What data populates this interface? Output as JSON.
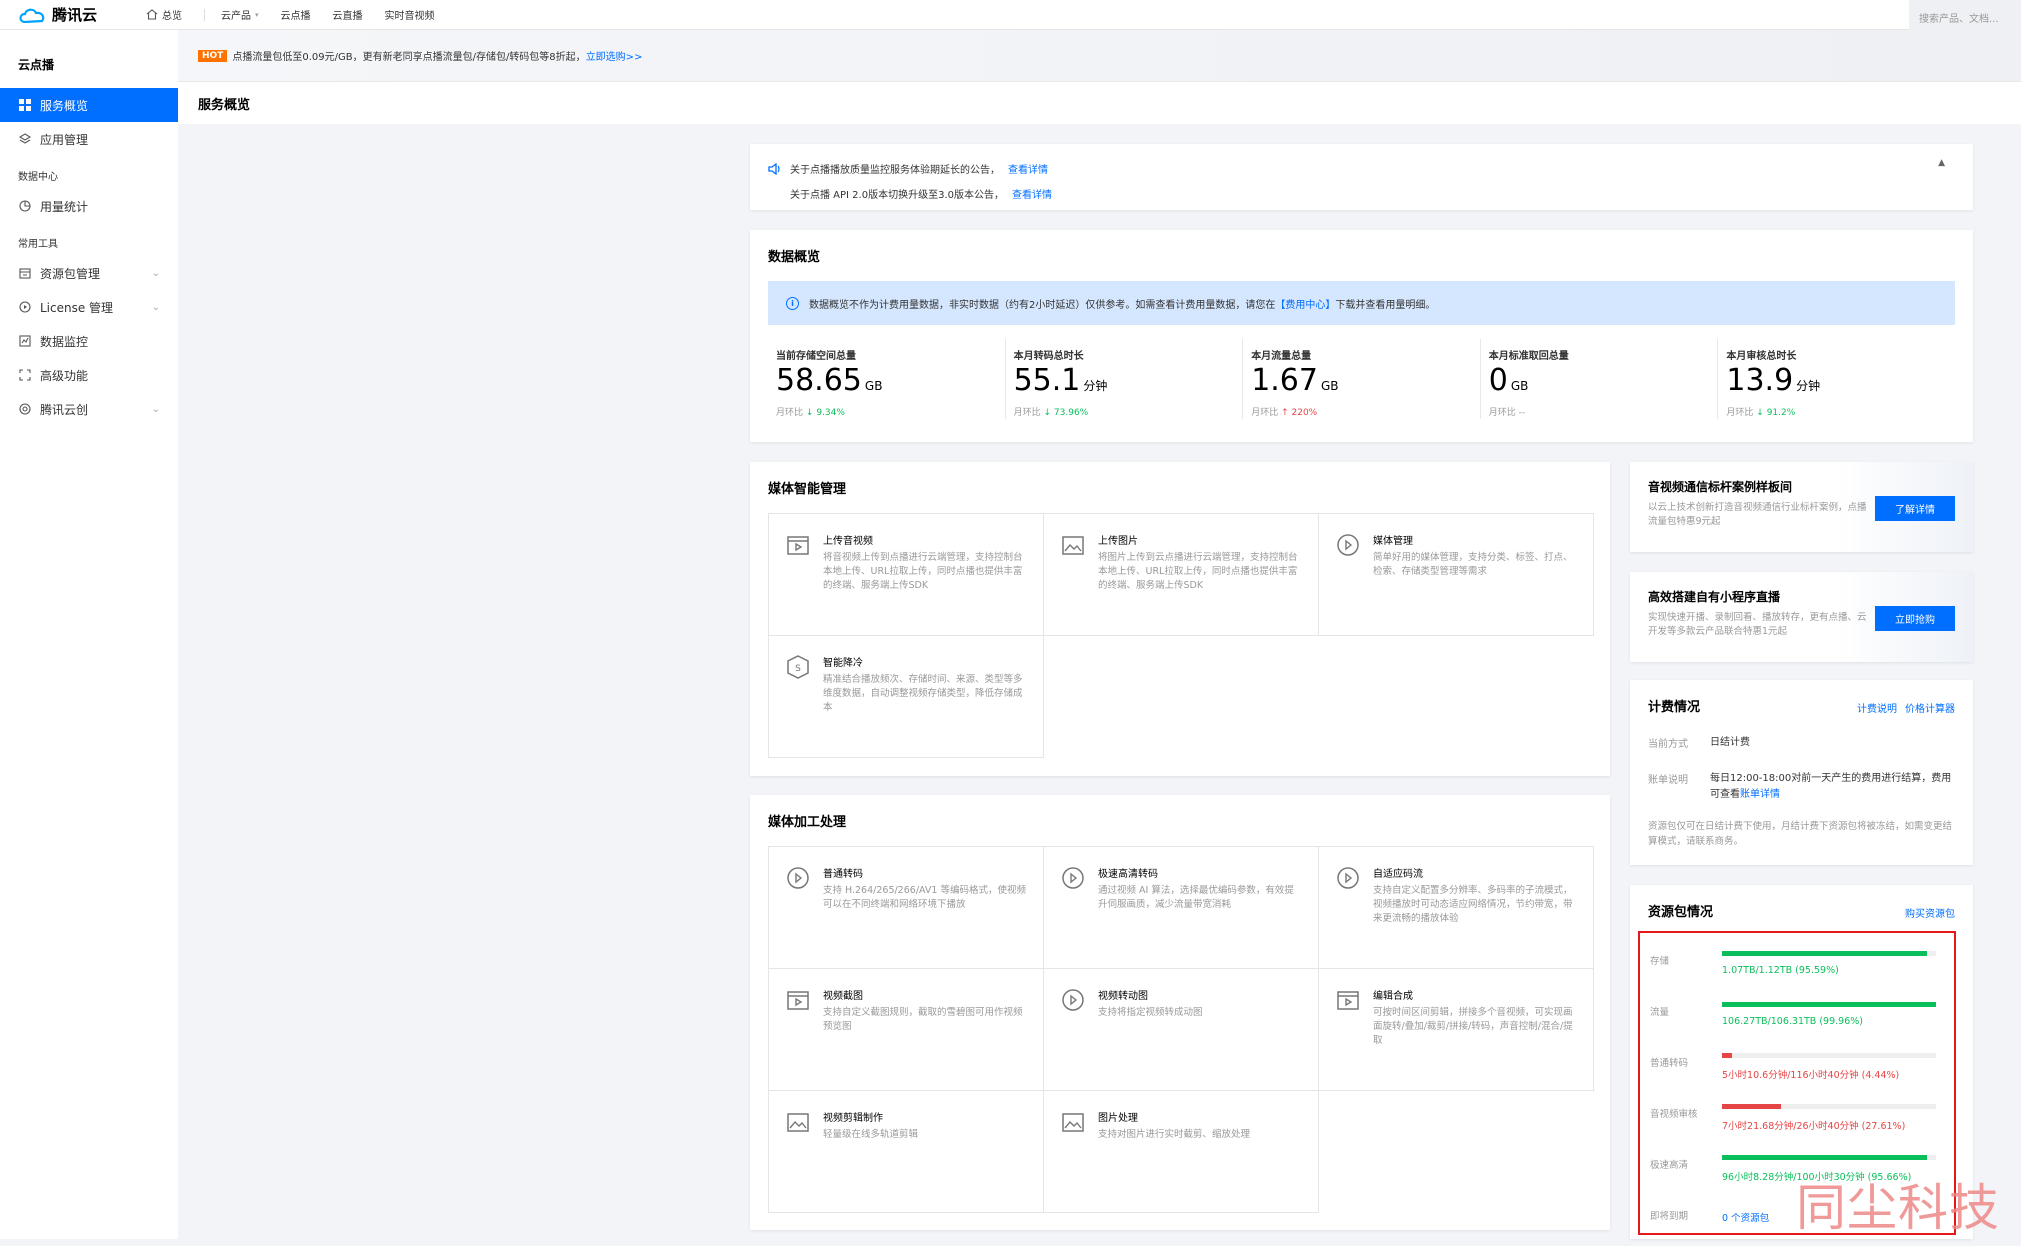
{
  "topbar": {
    "brand": "腾讯云",
    "nav": [
      "总览",
      "云产品",
      "云点播",
      "云直播",
      "实时音视频"
    ],
    "search_placeholder": "搜索产品、文档..."
  },
  "sidebar": {
    "title": "云点播",
    "items": [
      {
        "label": "服务概览"
      },
      {
        "label": "应用管理"
      }
    ],
    "group1": "数据中心",
    "items2": [
      {
        "label": "用量统计"
      }
    ],
    "group2": "常用工具",
    "items3": [
      {
        "label": "资源包管理"
      },
      {
        "label": "License 管理"
      },
      {
        "label": "数据监控"
      },
      {
        "label": "高级功能"
      },
      {
        "label": "腾讯云创"
      }
    ]
  },
  "hotbar": {
    "badge": "HOT",
    "text": "点播流量包低至0.09元/GB，更有新老同享点播流量包/存储包/转码包等8折起，",
    "link": "立即选购>>"
  },
  "page_title": "服务概览",
  "notices": [
    {
      "text": "关于点播播放质量监控服务体验期延长的公告，",
      "link": "查看详情"
    },
    {
      "text": "关于点播 API 2.0版本切换升级至3.0版本公告，",
      "link": "查看详情"
    }
  ],
  "overview": {
    "title": "数据概览",
    "info_pre": "数据概览不作为计费用量数据，非实时数据（约有2小时延迟）仅供参考。如需查看计费用量数据，请您在",
    "info_link": "【费用中心】",
    "info_post": "下载并查看用量明细。",
    "stats": [
      {
        "label": "当前存储空间总量",
        "value": "58.65",
        "unit": "GB",
        "cmp": "月环比",
        "arrow": "↓",
        "pct": "9.34%"
      },
      {
        "label": "本月转码总时长",
        "value": "55.1",
        "unit": "分钟",
        "cmp": "月环比",
        "arrow": "↓",
        "pct": "73.96%"
      },
      {
        "label": "本月流量总量",
        "value": "1.67",
        "unit": "GB",
        "cmp": "月环比",
        "arrow": "↑",
        "pct": "220%"
      },
      {
        "label": "本月标准取回总量",
        "value": "0",
        "unit": "GB",
        "cmp": "月环比",
        "arrow": "",
        "pct": "--"
      },
      {
        "label": "本月审核总时长",
        "value": "13.9",
        "unit": "分钟",
        "cmp": "月环比",
        "arrow": "↓",
        "pct": "91.2%"
      }
    ]
  },
  "media_mgmt": {
    "title": "媒体智能管理",
    "items": [
      {
        "t": "上传音视频",
        "d": "将音视频上传到点播进行云端管理，支持控制台本地上传、URL拉取上传，同时点播也提供丰富的终端、服务端上传SDK"
      },
      {
        "t": "上传图片",
        "d": "将图片上传到云点播进行云端管理，支持控制台本地上传、URL拉取上传，同时点播也提供丰富的终端、服务端上传SDK"
      },
      {
        "t": "媒体管理",
        "d": "简单好用的媒体管理，支持分类、标签、打点、检索、存储类型管理等需求"
      },
      {
        "t": "智能降冷",
        "d": "精准结合播放频次、存储时间、来源、类型等多维度数据，自动调整视频存储类型，降低存储成本"
      }
    ]
  },
  "media_proc": {
    "title": "媒体加工处理",
    "items": [
      {
        "t": "普通转码",
        "d": "支持 H.264/265/266/AV1 等编码格式，使视频可以在不同终端和网络环境下播放"
      },
      {
        "t": "极速高清转码",
        "d": "通过视频 AI 算法，选择最优编码参数，有效提升伺服画质，减少流量带宽消耗"
      },
      {
        "t": "自适应码流",
        "d": "支持自定义配置多分辨率、多码率的子流模式，视频播放时可动态适应网络情况，节约带宽，带来更流畅的播放体验"
      },
      {
        "t": "视频截图",
        "d": "支持自定义截图规则，截取的雪碧图可用作视频预览图"
      },
      {
        "t": "视频转动图",
        "d": "支持将指定视频转成动图"
      },
      {
        "t": "编辑合成",
        "d": "可按时间区间剪辑，拼接多个音视频，可实现画面旋转/叠加/裁剪/拼接/转码，声音控制/混合/提取"
      },
      {
        "t": "视频剪辑制作",
        "d": "轻量级在线多轨道剪辑"
      },
      {
        "t": "图片处理",
        "d": "支持对图片进行实时截剪、缩放处理"
      }
    ]
  },
  "promos": [
    {
      "t": "音视频通信标杆案例样板间",
      "d": "以云上技术创新打造音视频通信行业标杆案例，点播流量包特惠9元起",
      "btn": "了解详情"
    },
    {
      "t": "高效搭建自有小程序直播",
      "d": "实现快速开播、录制回看、播放转存，更有点播、云开发等多款云产品联合特惠1元起",
      "btn": "立即抢购"
    }
  ],
  "billing": {
    "title": "计费情况",
    "link1": "计费说明",
    "link2": "价格计算器",
    "mode_k": "当前方式",
    "mode_v": "日结计费",
    "bill_k": "账单说明",
    "bill_v": "每日12:00-18:00对前一天产生的费用进行结算，费用可查看",
    "bill_link": "账单详情",
    "note": "资源包仅可在日结计费下使用，月结计费下资源包将被冻结，如需变更结算模式，请联系商务。"
  },
  "resource": {
    "title": "资源包情况",
    "buy": "购买资源包",
    "rows": [
      {
        "k": "存储",
        "v": "1.07TB/1.12TB (95.59%)",
        "pct": 95.59,
        "color": "#0abf5b"
      },
      {
        "k": "流量",
        "v": "106.27TB/106.31TB (99.96%)",
        "pct": 99.96,
        "color": "#0abf5b"
      },
      {
        "k": "普通转码",
        "v": "5小时10.6分钟/116小时40分钟 (4.44%)",
        "pct": 4.44,
        "color": "#e54545"
      },
      {
        "k": "音视频审核",
        "v": "7小时21.68分钟/26小时40分钟 (27.61%)",
        "pct": 27.61,
        "color": "#e54545"
      },
      {
        "k": "极速高清",
        "v": "96小时8.28分钟/100小时30分钟 (95.66%)",
        "pct": 95.66,
        "color": "#0abf5b"
      },
      {
        "k": "即将到期",
        "v": "0 个资源包",
        "pct": null,
        "color": "#006eff"
      }
    ]
  },
  "watermark": "同尘科技"
}
